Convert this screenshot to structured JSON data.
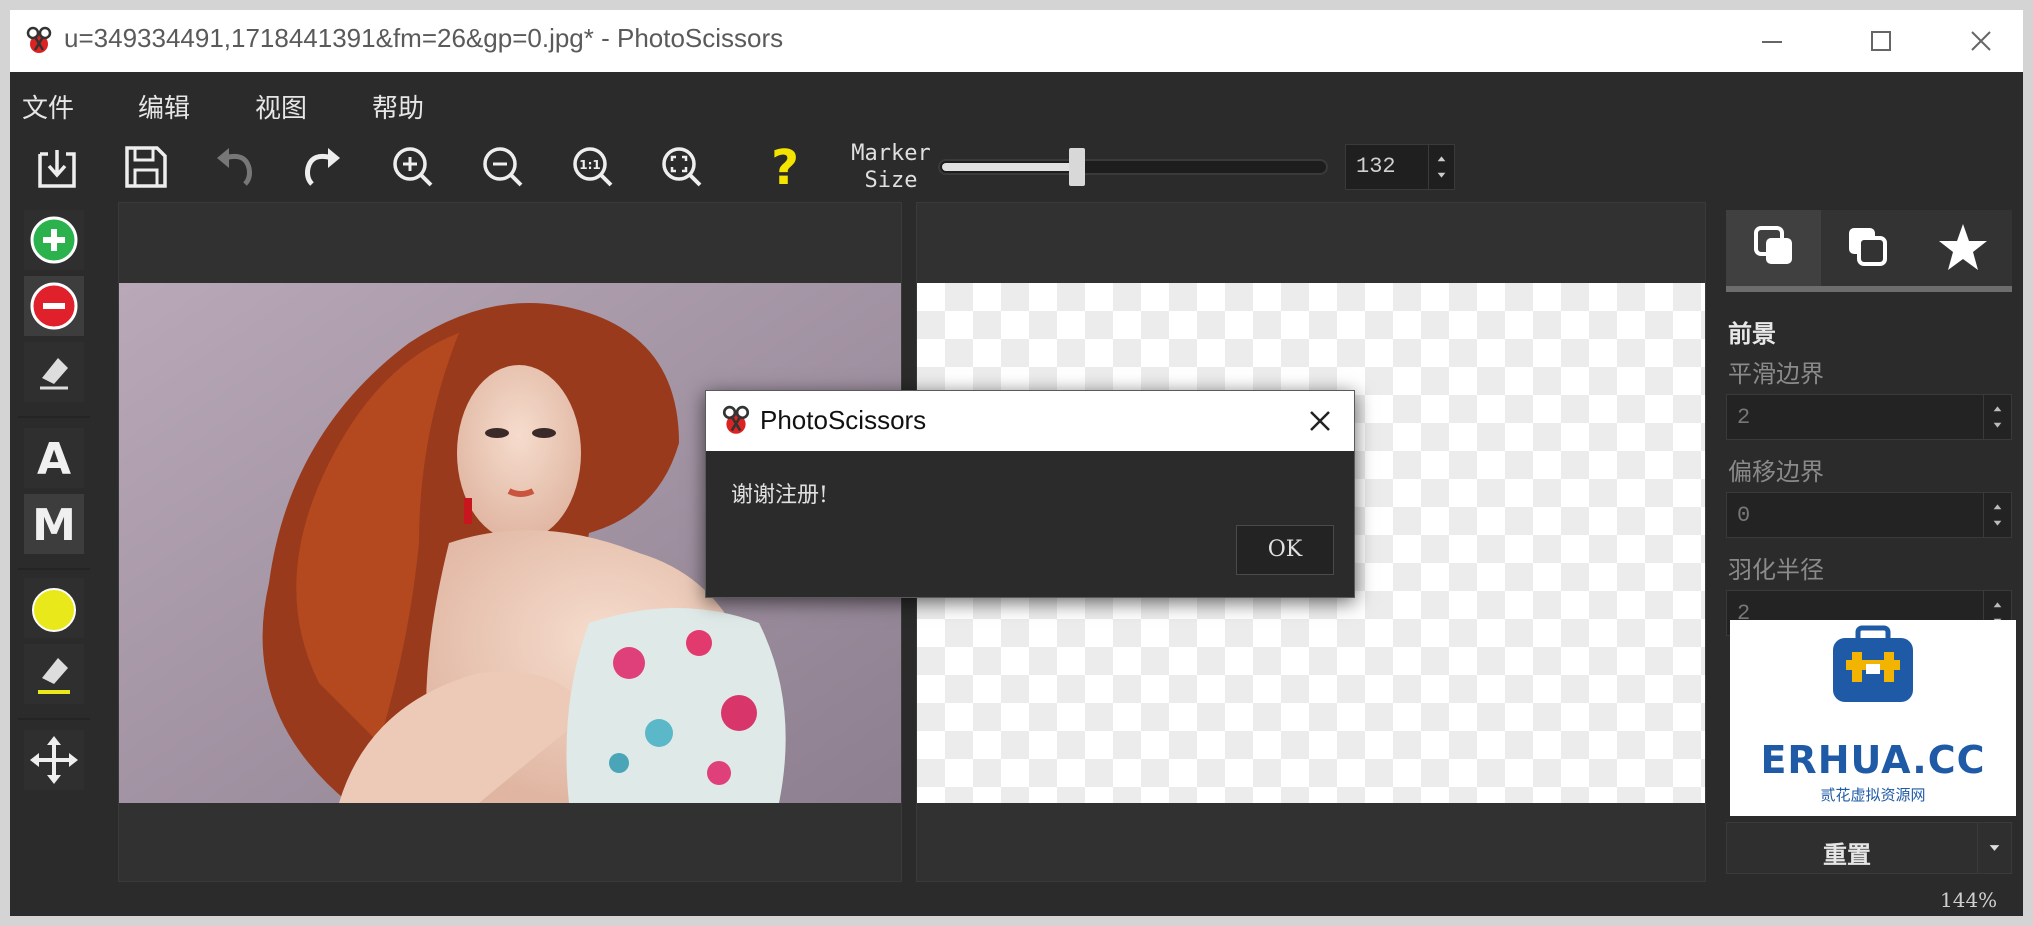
{
  "window": {
    "title": "u=349334491,1718441391&fm=26&gp=0.jpg* - PhotoScissors"
  },
  "menu": {
    "items": [
      "文件",
      "编辑",
      "视图",
      "帮助"
    ]
  },
  "toolbar": {
    "marker_label_1": "Marker",
    "marker_label_2": "Size",
    "marker_size": "132",
    "marker_fraction": 0.35,
    "buttons": [
      "open",
      "save",
      "undo",
      "redo",
      "zoom-in",
      "zoom-out",
      "zoom-1to1",
      "zoom-fit",
      "help"
    ]
  },
  "palette": {
    "text_tool_a": "A",
    "text_tool_m": "M",
    "tools": [
      "foreground-marker",
      "background-marker",
      "eraser",
      "auto-mode",
      "manual-mode",
      "color-marker",
      "color-eraser",
      "move"
    ]
  },
  "right_panel": {
    "section_title": "前景",
    "smooth_label": "平滑边界",
    "smooth_value": "2",
    "offset_label": "偏移边界",
    "offset_value": "0",
    "feather_label": "羽化半径",
    "feather_value": "2",
    "reset_label": "重置"
  },
  "status": {
    "zoom": "144%"
  },
  "dialog": {
    "title": "PhotoScissors",
    "message": "谢谢注册!",
    "ok_label": "OK"
  },
  "watermark": {
    "brand": "ERHUA.CC",
    "subtitle": "贰花虚拟资源网"
  },
  "colors": {
    "accent_green": "#2bb24c",
    "accent_red": "#e0202a",
    "accent_yellow": "#e8e81a",
    "help_yellow": "#f5e400",
    "brand_blue": "#1f5aa6",
    "brand_gold": "#f2b400"
  }
}
